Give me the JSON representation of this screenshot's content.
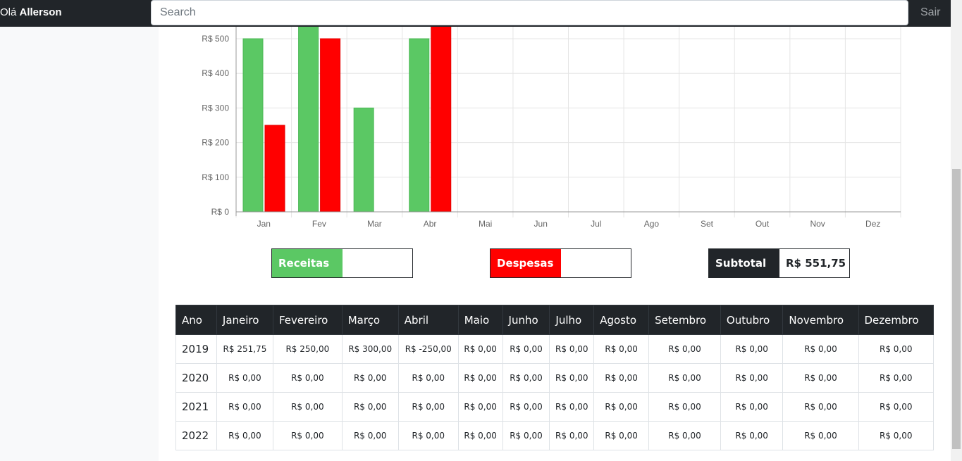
{
  "navbar": {
    "greeting": "Olá",
    "user_name": "Allerson",
    "search_placeholder": "Search",
    "logout_label": "Sair"
  },
  "colors": {
    "receitas": "#5bc864",
    "despesas": "#ff0000",
    "dark": "#212529"
  },
  "chart_data": {
    "type": "bar",
    "categories": [
      "Jan",
      "Fev",
      "Mar",
      "Abr",
      "Mai",
      "Jun",
      "Jul",
      "Ago",
      "Set",
      "Out",
      "Nov",
      "Dez"
    ],
    "series": [
      {
        "values": [
          500,
          540,
          300,
          500,
          0,
          0,
          0,
          0,
          0,
          0,
          0,
          0
        ],
        "color": "#5bc864"
      },
      {
        "values": [
          250,
          500,
          0,
          540,
          0,
          0,
          0,
          0,
          0,
          0,
          0,
          0
        ],
        "color": "#ff0000"
      }
    ],
    "y_ticks": [
      "R$ 0",
      "R$ 100",
      "R$ 200",
      "R$ 300",
      "R$ 400",
      "R$ 500"
    ],
    "ylim": [
      0,
      550
    ],
    "grid": true
  },
  "summary": {
    "receitas_label": "Receitas",
    "receitas_value": "",
    "despesas_label": "Despesas",
    "despesas_value": "",
    "subtotal_label": "Subtotal",
    "subtotal_value": "R$ 551,75"
  },
  "table": {
    "headers": [
      "Ano",
      "Janeiro",
      "Fevereiro",
      "Março",
      "Abril",
      "Maio",
      "Junho",
      "Julho",
      "Agosto",
      "Setembro",
      "Outubro",
      "Novembro",
      "Dezembro"
    ],
    "rows": [
      {
        "year": "2019",
        "values": [
          "R$ 251,75",
          "R$ 250,00",
          "R$ 300,00",
          "R$ -250,00",
          "R$ 0,00",
          "R$ 0,00",
          "R$ 0,00",
          "R$ 0,00",
          "R$ 0,00",
          "R$ 0,00",
          "R$ 0,00",
          "R$ 0,00"
        ]
      },
      {
        "year": "2020",
        "values": [
          "R$ 0,00",
          "R$ 0,00",
          "R$ 0,00",
          "R$ 0,00",
          "R$ 0,00",
          "R$ 0,00",
          "R$ 0,00",
          "R$ 0,00",
          "R$ 0,00",
          "R$ 0,00",
          "R$ 0,00",
          "R$ 0,00"
        ]
      },
      {
        "year": "2021",
        "values": [
          "R$ 0,00",
          "R$ 0,00",
          "R$ 0,00",
          "R$ 0,00",
          "R$ 0,00",
          "R$ 0,00",
          "R$ 0,00",
          "R$ 0,00",
          "R$ 0,00",
          "R$ 0,00",
          "R$ 0,00",
          "R$ 0,00"
        ]
      },
      {
        "year": "2022",
        "values": [
          "R$ 0,00",
          "R$ 0,00",
          "R$ 0,00",
          "R$ 0,00",
          "R$ 0,00",
          "R$ 0,00",
          "R$ 0,00",
          "R$ 0,00",
          "R$ 0,00",
          "R$ 0,00",
          "R$ 0,00",
          "R$ 0,00"
        ]
      }
    ]
  }
}
